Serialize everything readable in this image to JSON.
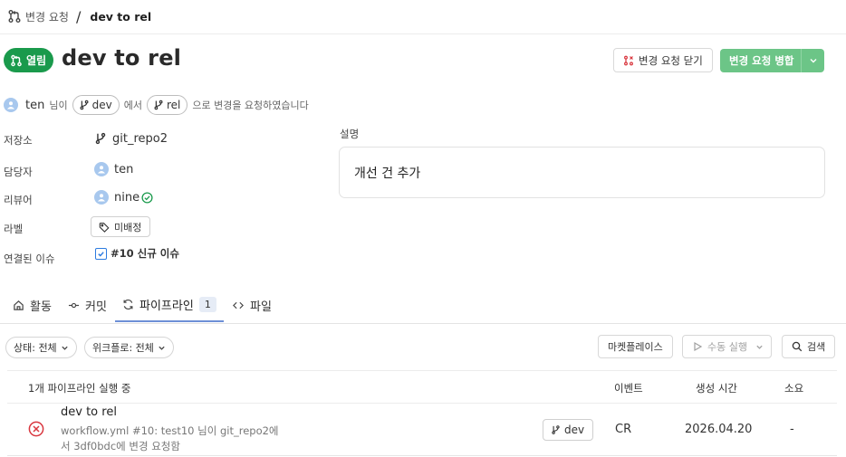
{
  "breadcrumb": {
    "section": "변경 요청",
    "separator": "/",
    "current": "dev to rel"
  },
  "header": {
    "status_badge": "열림",
    "title": "dev to rel",
    "close_button": "변경 요청 닫기",
    "merge_button": "변경 요청 병합"
  },
  "request": {
    "user": "ten",
    "text1": "님이",
    "source_branch": "dev",
    "text2": "에서",
    "target_branch": "rel",
    "text3": "으로 변경을 요청하였습니다"
  },
  "properties": {
    "repository_label": "저장소",
    "repository_value": "git_repo2",
    "assignee_label": "담당자",
    "assignee_value": "ten",
    "reviewer_label": "리뷰어",
    "reviewer_value": "nine",
    "labels_label": "라벨",
    "labels_value": "미배정",
    "linked_issue_label": "연결된 이슈",
    "linked_issue_value": "#10 신규 이슈"
  },
  "description": {
    "label": "설명",
    "text": "개선 건 추가"
  },
  "tabs": [
    {
      "label": "활동",
      "icon": "home-icon"
    },
    {
      "label": "커밋",
      "icon": "commit-icon"
    },
    {
      "label": "파이프라인",
      "icon": "pipeline-icon",
      "count": "1"
    },
    {
      "label": "파일",
      "icon": "code-icon"
    }
  ],
  "filters": {
    "status": "상태: 전체",
    "workflow": "위크플로: 전체",
    "marketplace": "마켓플레이스",
    "manual_run": "수동 실행",
    "search": "검색"
  },
  "table": {
    "summary": "1개 파이프라인 실행 중",
    "col_event": "이벤트",
    "col_created": "생성 시간",
    "col_duration": "소요",
    "rows": [
      {
        "title": "dev to rel",
        "detail": "workflow.yml #10: test10 님이 git_repo2에서 3df0bdc에 변경 요청함",
        "branch": "dev",
        "event": "CR",
        "created": "2026.04.20",
        "duration": "-"
      }
    ]
  },
  "colors": {
    "open_badge": "#1a9a4c",
    "merge_button": "#6cc587",
    "active_tab": "#6d8fd6",
    "fail": "#d9363e",
    "reviewer_check": "#1a9a4c"
  }
}
